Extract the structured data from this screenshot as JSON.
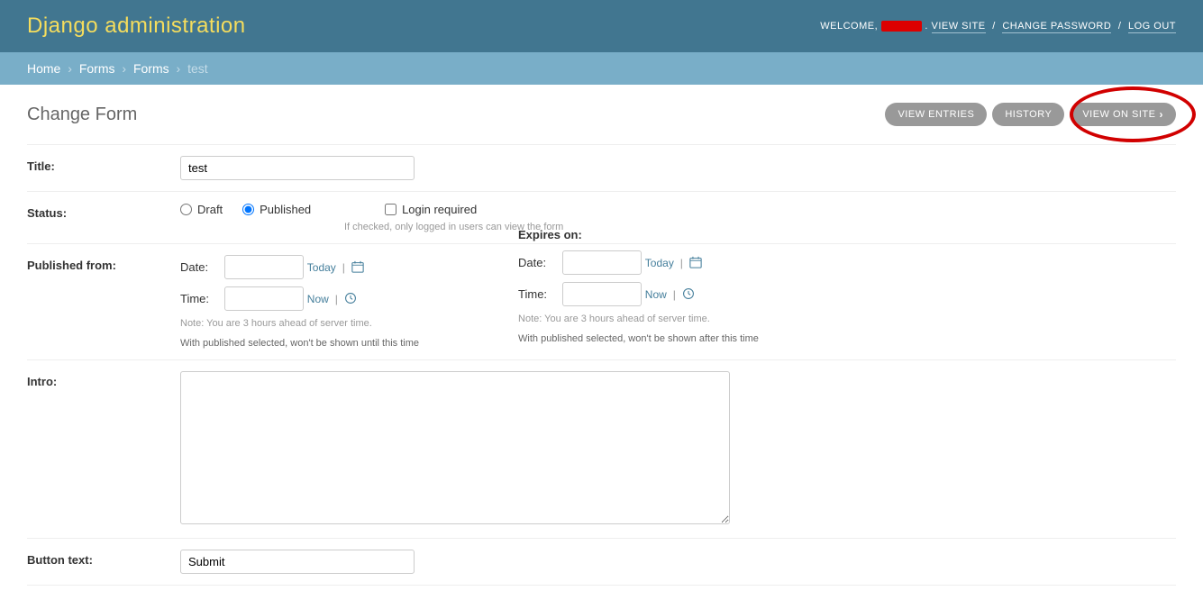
{
  "header": {
    "branding": "Django administration",
    "welcome": "WELCOME,",
    "view_site": "VIEW SITE",
    "change_password": "CHANGE PASSWORD",
    "logout": "LOG OUT"
  },
  "breadcrumbs": {
    "home": "Home",
    "forms1": "Forms",
    "forms2": "Forms",
    "current": "test"
  },
  "title": "Change Form",
  "tools": {
    "view_entries": "View Entries",
    "history": "History",
    "view_on_site": "View on site"
  },
  "fields": {
    "title_label": "Title:",
    "title_value": "test",
    "status_label": "Status:",
    "status_draft": "Draft",
    "status_published": "Published",
    "status_login": "Login required",
    "status_login_help": "If checked, only logged in users can view the form",
    "pub_from_label": "Published from:",
    "expires_label": "Expires on:",
    "date_label": "Date:",
    "time_label": "Time:",
    "today": "Today",
    "now": "Now",
    "tz_note": "Note: You are 3 hours ahead of server time.",
    "pub_from_desc": "With published selected, won't be shown until this time",
    "expires_desc": "With published selected, won't be shown after this time",
    "intro_label": "Intro:",
    "button_text_label": "Button text:",
    "button_text_value": "Submit"
  }
}
